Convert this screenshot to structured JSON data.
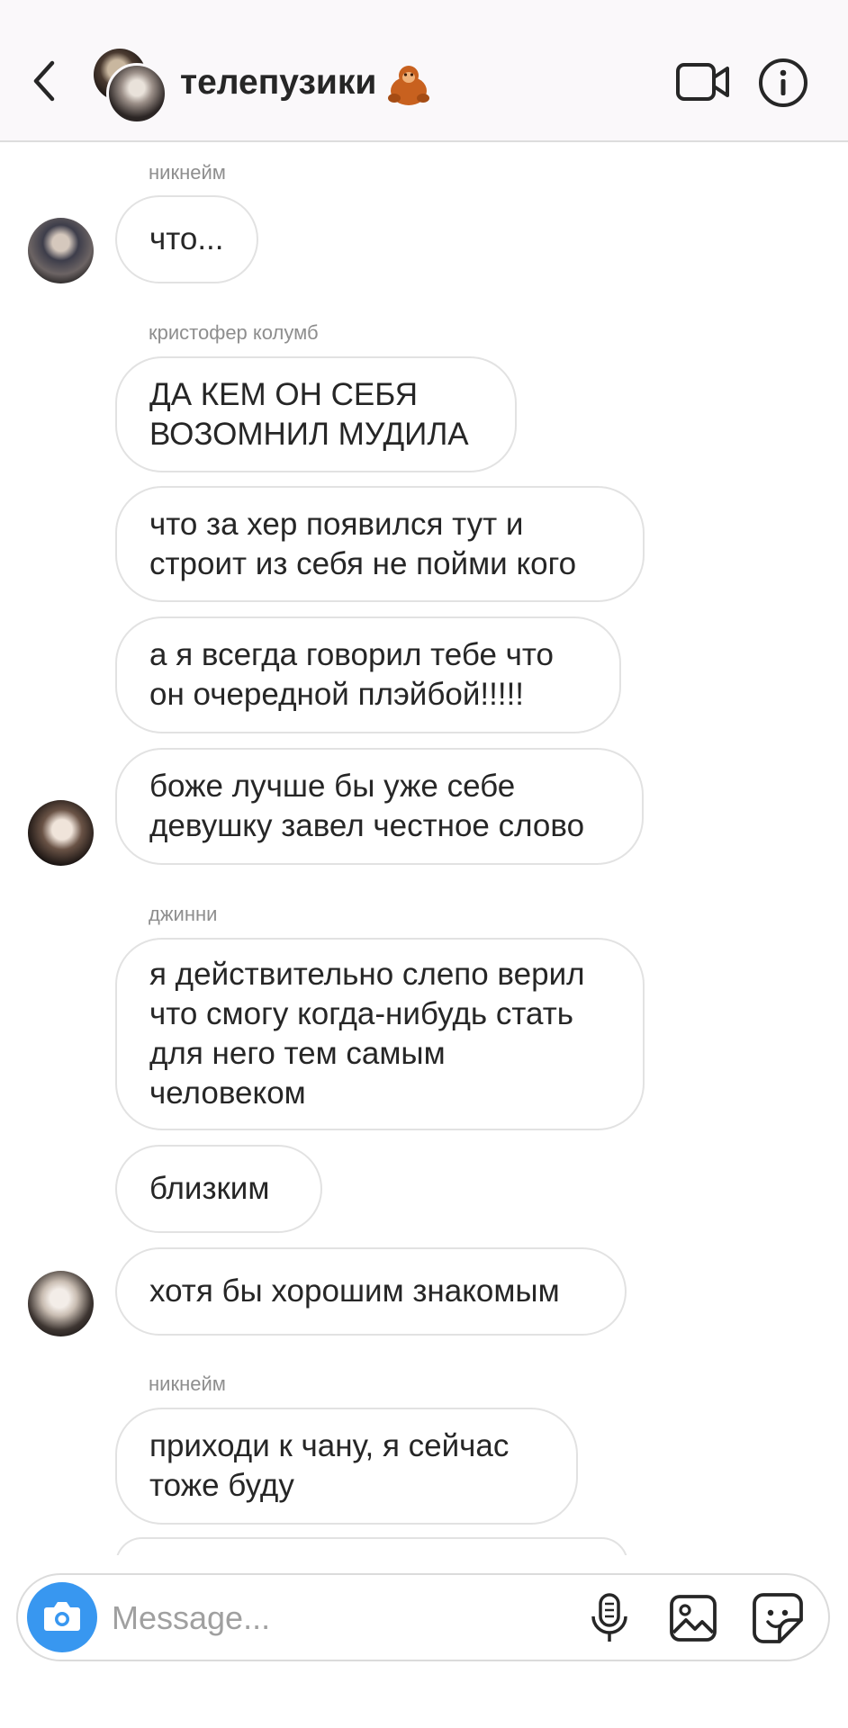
{
  "header": {
    "title": "телепузики",
    "title_emoji": "orangutan-emoji",
    "back_icon": "chevron-left-icon",
    "video_icon": "video-camera-icon",
    "info_icon": "info-icon"
  },
  "messages": [
    {
      "sender": "никнейм",
      "lines": [
        "что..."
      ]
    },
    {
      "sender": "кристофер колумб",
      "lines": [
        "ДА КЕМ ОН СЕБЯ",
        "ВОЗОМНИЛ МУДИЛА"
      ]
    },
    {
      "lines": [
        "что за хер появился тут и",
        "строит из себя не пойми кого"
      ]
    },
    {
      "lines": [
        "а я всегда говорил тебе что",
        "он очередной плэйбой!!!!!"
      ]
    },
    {
      "lines": [
        "боже лучше бы уже себе",
        "девушку завел честное слово"
      ]
    },
    {
      "sender": "джинни",
      "lines": [
        "я действительно слепо верил",
        "что смогу когда-нибудь стать",
        "для него тем самым",
        "человеком"
      ]
    },
    {
      "lines": [
        "близким"
      ]
    },
    {
      "lines": [
        "хотя бы хорошим знакомым"
      ]
    },
    {
      "sender": "никнейм",
      "lines": [
        "приходи к чану, я сейчас",
        "тоже буду"
      ]
    }
  ],
  "composer": {
    "placeholder": "Message...",
    "camera_icon": "camera-icon",
    "mic_icon": "microphone-icon",
    "gallery_icon": "image-gallery-icon",
    "sticker_icon": "sticker-icon"
  },
  "colors": {
    "accent": "#3897f0",
    "header_bg": "#faf8fa",
    "bubble_border": "#e2e2e2",
    "sender_name": "#8e8e8e"
  }
}
